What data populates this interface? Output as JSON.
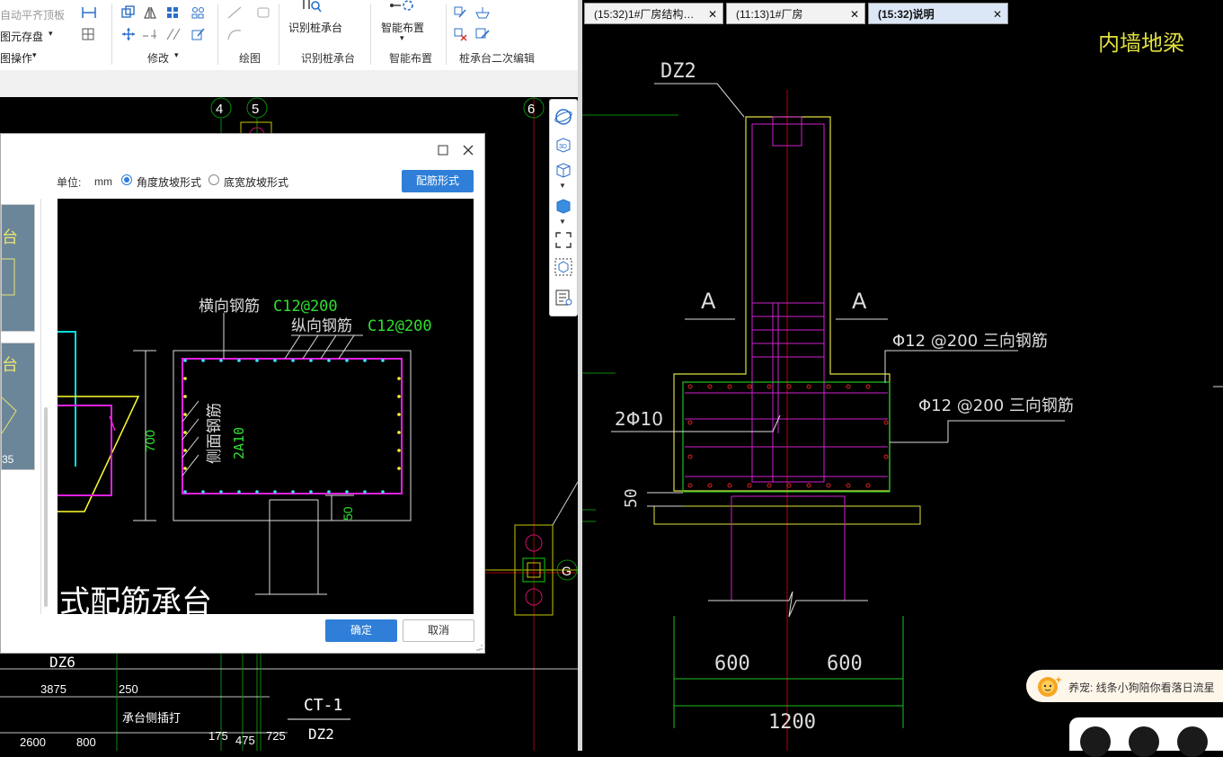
{
  "ribbon": {
    "row1": [
      "自动平齐顶板",
      "识别桩承台",
      "智能布置"
    ],
    "row2": [
      "图元存盘"
    ],
    "row3": [
      "图操作"
    ],
    "groups": [
      "修改",
      "绘图",
      "识别桩承台",
      "智能布置",
      "桩承台二次编辑"
    ]
  },
  "left_cad": {
    "axes": [
      "4",
      "5",
      "6",
      "G"
    ],
    "labels": [
      "DZ6",
      "3875",
      "250",
      "2600",
      "800",
      "175",
      "475",
      "725",
      "承台侧插打",
      "CT-1",
      "DZ2"
    ]
  },
  "dialog": {
    "unit_label": "单位:",
    "unit_value": "mm",
    "radio1": "角度放坡形式",
    "radio2": "底宽放坡形式",
    "rebar_button": "配筋形式",
    "preview": {
      "transverse_label": "横向钢筋",
      "transverse_value": "C12@200",
      "longitudinal_label": "纵向钢筋",
      "longitudinal_value": "C12@200",
      "side_label": "侧面钢筋",
      "side_value": "2A10",
      "dim_height": "700",
      "dim_bottom": "50",
      "big_title": "式配筋承台"
    },
    "thumb_texts": [
      "台",
      "台",
      "35"
    ],
    "ok": "确定",
    "cancel": "取消"
  },
  "tabs": [
    {
      "label": "(15:32)1#厂房结构…"
    },
    {
      "label": "(11:13)1#厂房"
    },
    {
      "label": "(15:32)说明"
    }
  ],
  "right_cad": {
    "title": "内墙地梁",
    "column": "DZ2",
    "section_a": "A",
    "rebar1": "Φ12 @200 三向钢筋",
    "rebar2": "Φ12 @200 三向钢筋",
    "bars": "2Φ10",
    "dim50": "50",
    "dim600a": "600",
    "dim600b": "600",
    "dim1200": "1200"
  },
  "notification": {
    "text": "养宠: 线条小狗陪你看落日流星"
  }
}
